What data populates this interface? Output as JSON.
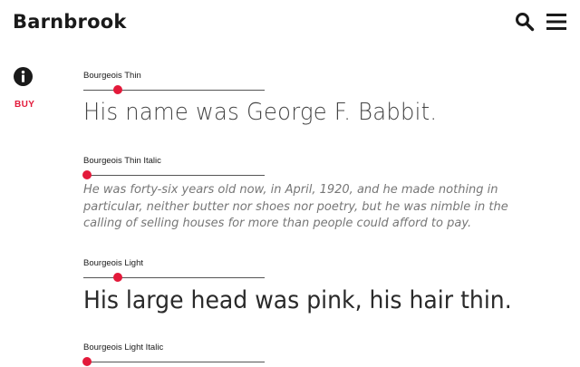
{
  "header": {
    "logo": "Barnbrook",
    "search_icon": "search-icon",
    "menu_icon": "hamburger-menu-icon"
  },
  "sidebar": {
    "info_icon": "info-icon",
    "buy_label": "BUY"
  },
  "colors": {
    "accent": "#e3193a",
    "text": "#1a1a1a"
  },
  "specimens": [
    {
      "font_name": "Bourgeois Thin",
      "slider_value": 0.19,
      "sample": "His name was George F. Babbit."
    },
    {
      "font_name": "Bourgeois Thin Italic",
      "slider_value": 0.02,
      "sample": "He was forty-six years old now, in April, 1920, and he made nothing in particular, neither butter nor shoes nor poetry, but he was nimble in the calling of selling houses for more than people could afford to pay."
    },
    {
      "font_name": "Bourgeois Light",
      "slider_value": 0.19,
      "sample": "His large head was pink, his hair thin."
    },
    {
      "font_name": "Bourgeois Light Italic",
      "slider_value": 0.02,
      "sample": ""
    }
  ]
}
